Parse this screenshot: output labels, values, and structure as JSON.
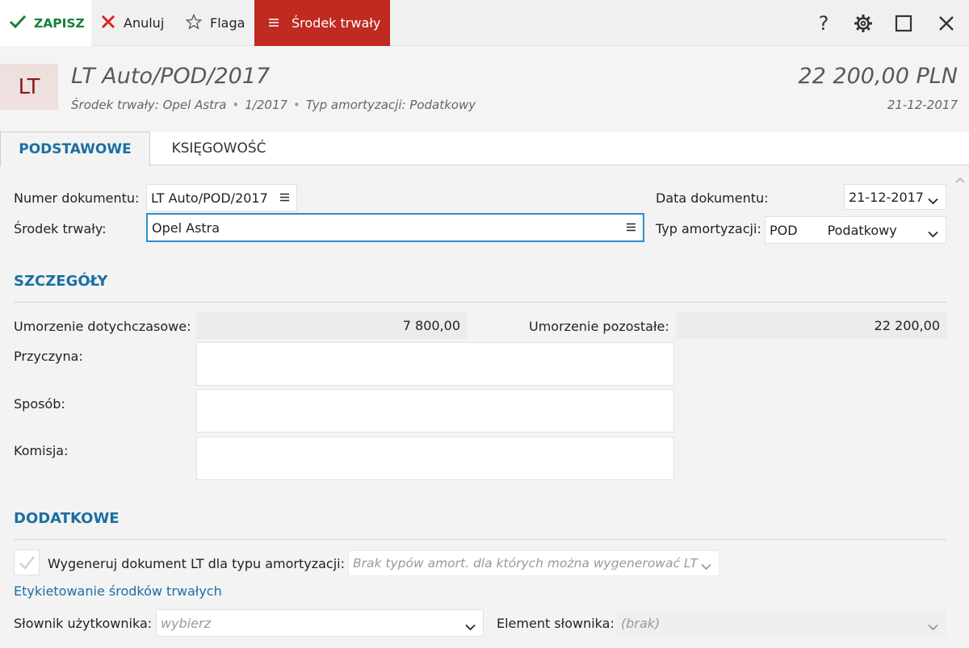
{
  "toolbar": {
    "save_label": "ZAPISZ",
    "cancel_label": "Anuluj",
    "flag_label": "Flaga",
    "asset_label": "Środek trwały"
  },
  "header": {
    "avatar": "LT",
    "title": "LT Auto/POD/2017",
    "subtitle_asset": "Środek trwały: Opel Astra",
    "subtitle_period": "1/2017",
    "subtitle_type": "Typ amortyzacji: Podatkowy",
    "amount": "22 200,00 PLN",
    "date": "21-12-2017"
  },
  "tabs": [
    "PODSTAWOWE",
    "KSIĘGOWOŚĆ"
  ],
  "form": {
    "doc_number_label": "Numer dokumentu:",
    "doc_number_value": "LT Auto/POD/2017",
    "asset_label": "Środek trwały:",
    "asset_value": "Opel Astra",
    "doc_date_label": "Data dokumentu:",
    "doc_date_value": "21-12-2017",
    "amort_type_label": "Typ amortyzacji:",
    "amort_type_code": "POD",
    "amort_type_name": "Podatkowy"
  },
  "details": {
    "title": "SZCZEGÓŁY",
    "write_off_label": "Umorzenie dotychczasowe:",
    "write_off_value": "7 800,00",
    "remaining_label": "Umorzenie pozostałe:",
    "remaining_value": "22 200,00",
    "reason_label": "Przyczyna:",
    "method_label": "Sposób:",
    "commission_label": "Komisja:"
  },
  "additional": {
    "title": "DODATKOWE",
    "generate_label": "Wygeneruj dokument LT dla typu amortyzacji:",
    "generate_placeholder": "Brak typów amort. dla których można wygenerować LT",
    "labeling_link": "Etykietowanie środków trwałych",
    "dictionary_label": "Słownik użytkownika:",
    "dictionary_placeholder": "wybierz",
    "element_label": "Element słownika:",
    "element_placeholder": "(brak)"
  },
  "colors": {
    "accent": "#1b6fa4",
    "save_green": "#17803a",
    "asset_red": "#bf2a21"
  },
  "icons": [
    "check-icon",
    "close-icon",
    "star-icon",
    "menu-icon",
    "help-icon",
    "gear-icon",
    "maximize-icon",
    "window-close-icon",
    "chevron-down-icon",
    "checkbox-icon"
  ]
}
